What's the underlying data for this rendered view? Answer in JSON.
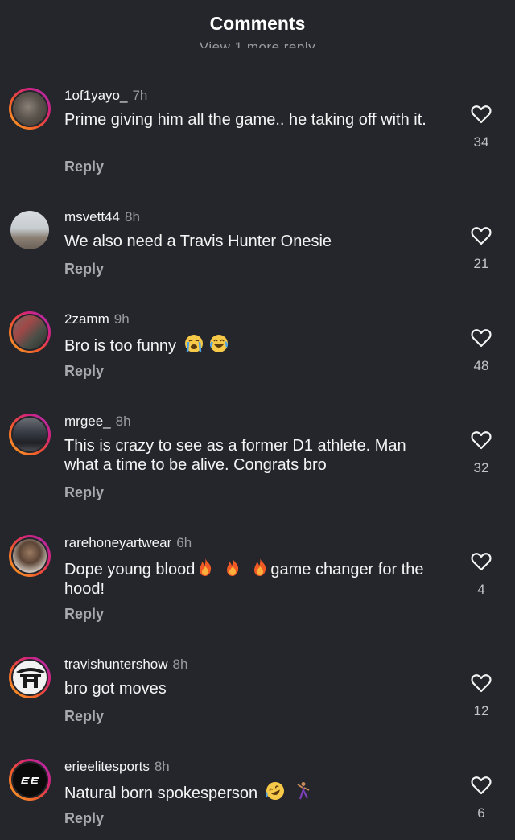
{
  "header": {
    "title": "Comments",
    "clipped_text": "View 1 more reply"
  },
  "comments": [
    {
      "username": "1of1yayo_",
      "time": "7h",
      "text": "Prime giving him all the game.. he taking off with it.",
      "reply_label": "Reply",
      "likes": "34",
      "avatar_ring": true
    },
    {
      "username": "msvett44",
      "time": "8h",
      "text": "We also need a Travis Hunter Onesie",
      "reply_label": "Reply",
      "likes": "21",
      "avatar_ring": false
    },
    {
      "username": "2zamm",
      "time": "9h",
      "text": "Bro is too funny",
      "emojis": [
        "loudly-crying-face",
        "face-with-tears-of-joy"
      ],
      "reply_label": "Reply",
      "likes": "48",
      "avatar_ring": true
    },
    {
      "username": "mrgee_",
      "time": "8h",
      "text": "This is crazy to see as a former D1 athlete. Man what a time to be alive. Congrats bro",
      "reply_label": "Reply",
      "likes": "32",
      "avatar_ring": true
    },
    {
      "username": "rarehoneyartwear",
      "time": "6h",
      "text_before": "Dope young blood",
      "emojis": [
        "fire",
        "fire",
        "fire"
      ],
      "text_after": "game changer for the hood!",
      "reply_label": "Reply",
      "likes": "4",
      "avatar_ring": true
    },
    {
      "username": "travishuntershow",
      "time": "8h",
      "text": "bro got moves",
      "reply_label": "Reply",
      "likes": "12",
      "avatar_ring": true
    },
    {
      "username": "erieelitesports",
      "time": "8h",
      "text": "Natural born spokesperson",
      "emojis": [
        "rolling-on-the-floor-laughing",
        "person-dancing"
      ],
      "reply_label": "Reply",
      "likes": "6",
      "avatar_ring": true
    }
  ],
  "colors": {
    "background": "#25262b",
    "primary_text": "#f4f4f5",
    "secondary_text": "#9a9ba0",
    "story_ring_start": "#f9a825",
    "story_ring_end": "#a82fc0"
  },
  "icons": {
    "like": "heart-outline-icon"
  }
}
